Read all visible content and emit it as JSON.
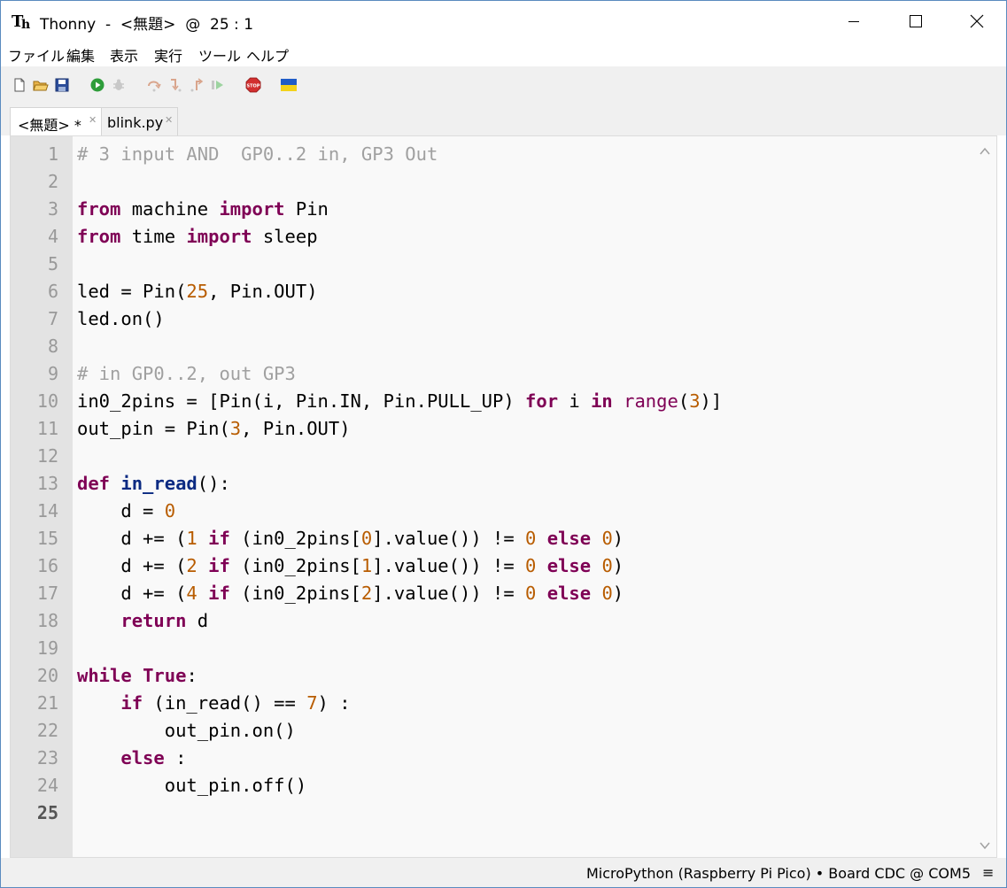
{
  "window": {
    "title": "Thonny  -  <無題>  @  25 : 1"
  },
  "menu": [
    "ファイル",
    "編集",
    "表示",
    "実行",
    "ツール",
    "ヘルプ"
  ],
  "toolbar": {
    "icons": [
      "new-file-icon",
      "open-file-icon",
      "save-icon",
      "run-icon",
      "debug-icon",
      "step-over-icon",
      "step-into-icon",
      "step-out-icon",
      "resume-icon",
      "stop-icon",
      "ukraine-flag-icon"
    ]
  },
  "tabs": [
    {
      "label": "<無題> *",
      "active": true
    },
    {
      "label": "blink.py",
      "active": false
    }
  ],
  "editor": {
    "current_line": 25,
    "lines": [
      [
        [
          "com",
          "# 3 input AND  GP0..2 in, GP3 Out"
        ]
      ],
      [],
      [
        [
          "kw",
          "from"
        ],
        [
          "",
          " machine "
        ],
        [
          "kw",
          "import"
        ],
        [
          "",
          " Pin"
        ]
      ],
      [
        [
          "kw",
          "from"
        ],
        [
          "",
          " time "
        ],
        [
          "kw",
          "import"
        ],
        [
          "",
          " sleep"
        ]
      ],
      [],
      [
        [
          "",
          "led = Pin("
        ],
        [
          "num",
          "25"
        ],
        [
          "",
          ", Pin.OUT)"
        ]
      ],
      [
        [
          "",
          "led.on()"
        ]
      ],
      [],
      [
        [
          "com",
          "# in GP0..2, out GP3"
        ]
      ],
      [
        [
          "",
          "in0_2pins = [Pin(i, Pin.IN, Pin.PULL_UP) "
        ],
        [
          "kw",
          "for"
        ],
        [
          "",
          " i "
        ],
        [
          "kw",
          "in"
        ],
        [
          "",
          " "
        ],
        [
          "bi",
          "range"
        ],
        [
          "",
          "("
        ],
        [
          "num",
          "3"
        ],
        [
          "",
          ")]"
        ]
      ],
      [
        [
          "",
          "out_pin = Pin("
        ],
        [
          "num",
          "3"
        ],
        [
          "",
          ", Pin.OUT)"
        ]
      ],
      [],
      [
        [
          "kw",
          "def"
        ],
        [
          "",
          " "
        ],
        [
          "def",
          "in_read"
        ],
        [
          "",
          "():"
        ]
      ],
      [
        [
          "",
          "    d = "
        ],
        [
          "num",
          "0"
        ]
      ],
      [
        [
          "",
          "    d += ("
        ],
        [
          "num",
          "1"
        ],
        [
          "",
          " "
        ],
        [
          "kw",
          "if"
        ],
        [
          "",
          " (in0_2pins["
        ],
        [
          "num",
          "0"
        ],
        [
          "",
          "].value()) != "
        ],
        [
          "num",
          "0"
        ],
        [
          "",
          " "
        ],
        [
          "kw",
          "else"
        ],
        [
          "",
          " "
        ],
        [
          "num",
          "0"
        ],
        [
          "",
          ")"
        ]
      ],
      [
        [
          "",
          "    d += ("
        ],
        [
          "num",
          "2"
        ],
        [
          "",
          " "
        ],
        [
          "kw",
          "if"
        ],
        [
          "",
          " (in0_2pins["
        ],
        [
          "num",
          "1"
        ],
        [
          "",
          "].value()) != "
        ],
        [
          "num",
          "0"
        ],
        [
          "",
          " "
        ],
        [
          "kw",
          "else"
        ],
        [
          "",
          " "
        ],
        [
          "num",
          "0"
        ],
        [
          "",
          ")"
        ]
      ],
      [
        [
          "",
          "    d += ("
        ],
        [
          "num",
          "4"
        ],
        [
          "",
          " "
        ],
        [
          "kw",
          "if"
        ],
        [
          "",
          " (in0_2pins["
        ],
        [
          "num",
          "2"
        ],
        [
          "",
          "].value()) != "
        ],
        [
          "num",
          "0"
        ],
        [
          "",
          " "
        ],
        [
          "kw",
          "else"
        ],
        [
          "",
          " "
        ],
        [
          "num",
          "0"
        ],
        [
          "",
          ")"
        ]
      ],
      [
        [
          "",
          "    "
        ],
        [
          "kw",
          "return"
        ],
        [
          "",
          " d"
        ]
      ],
      [],
      [
        [
          "kw",
          "while"
        ],
        [
          "",
          " "
        ],
        [
          "kw",
          "True"
        ],
        [
          "",
          ":"
        ]
      ],
      [
        [
          "",
          "    "
        ],
        [
          "kw",
          "if"
        ],
        [
          "",
          " (in_read() == "
        ],
        [
          "num",
          "7"
        ],
        [
          "",
          ") :"
        ]
      ],
      [
        [
          "",
          "        out_pin.on()"
        ]
      ],
      [
        [
          "",
          "    "
        ],
        [
          "kw",
          "else"
        ],
        [
          "",
          " :"
        ]
      ],
      [
        [
          "",
          "        out_pin.off()"
        ]
      ],
      []
    ]
  },
  "statusbar": {
    "text": "MicroPython (Raspberry Pi Pico)  •  Board CDC @ COM5",
    "menu_glyph": "≡"
  },
  "colors": {
    "keyword": "#7f0055",
    "comment": "#a0a0a0",
    "number": "#b85c00",
    "function_name": "#0b2a82",
    "gutter": "#e3e3e3",
    "editor_bg": "#f9f9f9"
  }
}
